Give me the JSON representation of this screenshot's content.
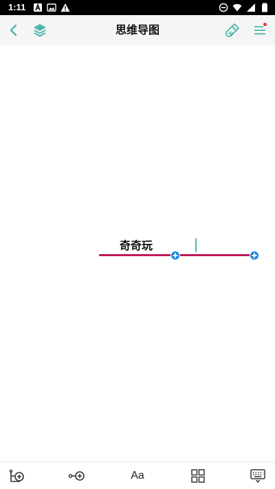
{
  "status_bar": {
    "time": "1:11",
    "left_icons": [
      "a-notification-icon",
      "image-notification-icon",
      "warning-icon"
    ],
    "right_icons": [
      "do-not-disturb-icon",
      "wifi-icon",
      "signal-icon",
      "battery-icon"
    ]
  },
  "toolbar": {
    "title": "思维导图",
    "icons": [
      "back-icon",
      "layers-icon",
      "brush-icon",
      "menu-icon"
    ],
    "accent_color": "#4db6ac",
    "notification_dot_color": "#e53935"
  },
  "canvas": {
    "node_text": "奇奇玩",
    "line_color": "#c2185b",
    "add_button_color": "#1e88e5"
  },
  "bottom_bar": {
    "icons": [
      "add-topic-icon",
      "add-child-topic-icon",
      "text-style-icon",
      "layout-grid-icon",
      "keyboard-icon"
    ],
    "text_style_label": "Aa"
  }
}
